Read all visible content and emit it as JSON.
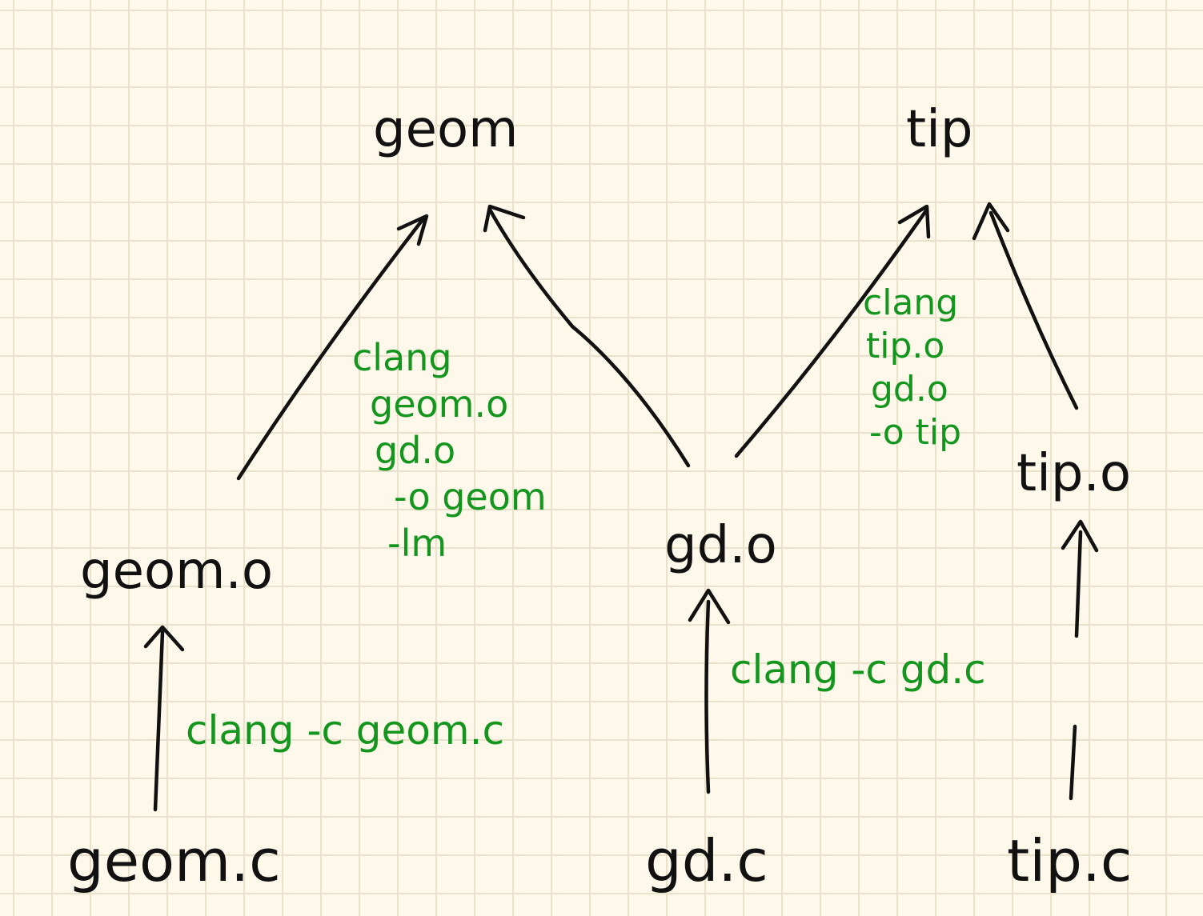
{
  "colors": {
    "paper": "#fdf8ea",
    "grid": "#e9e1c9",
    "ink": "#111111",
    "command_ink": "#14961e"
  },
  "nodes": {
    "geom": "geom",
    "tip": "tip",
    "geom_o": "geom.o",
    "gd_o": "gd.o",
    "tip_o": "tip.o",
    "geom_c": "geom.c",
    "gd_c": "gd.c",
    "tip_c": "tip.c"
  },
  "commands": {
    "compile_geom": "clang -c geom.c",
    "compile_gd": "clang -c gd.c",
    "link_geom": [
      "clang",
      "geom.o",
      "gd.o",
      "-o geom",
      "-lm"
    ],
    "link_tip": [
      "clang",
      "tip.o",
      "gd.o",
      "-o tip"
    ]
  }
}
